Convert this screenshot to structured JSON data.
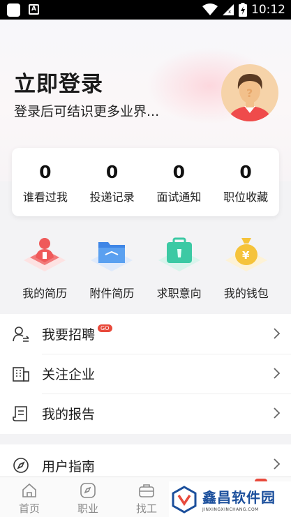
{
  "status_bar": {
    "time": "10:12",
    "notification_icon": "A"
  },
  "header": {
    "title": "立即登录",
    "subtitle": "登录后可结识更多业界...",
    "avatar_icon": "avatar-placeholder-icon"
  },
  "stats": [
    {
      "value": "0",
      "label": "谁看过我"
    },
    {
      "value": "0",
      "label": "投递记录"
    },
    {
      "value": "0",
      "label": "面试通知"
    },
    {
      "value": "0",
      "label": "职位收藏"
    }
  ],
  "quick_links": [
    {
      "label": "我的简历",
      "icon": "resume-icon",
      "color": "#ef5a5a"
    },
    {
      "label": "附件简历",
      "icon": "folder-icon",
      "color": "#4a90e8"
    },
    {
      "label": "求职意向",
      "icon": "briefcase-icon",
      "color": "#3cc9a4"
    },
    {
      "label": "我的钱包",
      "icon": "money-bag-icon",
      "color": "#f5c33b"
    }
  ],
  "menu": [
    {
      "label": "我要招聘",
      "badge": "GO",
      "icon": "recruit-icon"
    },
    {
      "label": "关注企业",
      "icon": "building-icon"
    },
    {
      "label": "我的报告",
      "icon": "report-icon"
    }
  ],
  "menu2": [
    {
      "label": "用户指南",
      "icon": "compass-icon"
    }
  ],
  "tabbar": [
    {
      "label": "首页",
      "icon": "home-icon"
    },
    {
      "label": "职业",
      "icon": "compass-icon"
    },
    {
      "label": "找工",
      "icon": "briefcase-icon"
    }
  ],
  "watermark": {
    "name": "鑫昌软件园",
    "url": "JINXINGXINCHANG.COM"
  },
  "colors": {
    "accent_red": "#e84a3c",
    "watermark_blue": "#1b4f9c"
  }
}
